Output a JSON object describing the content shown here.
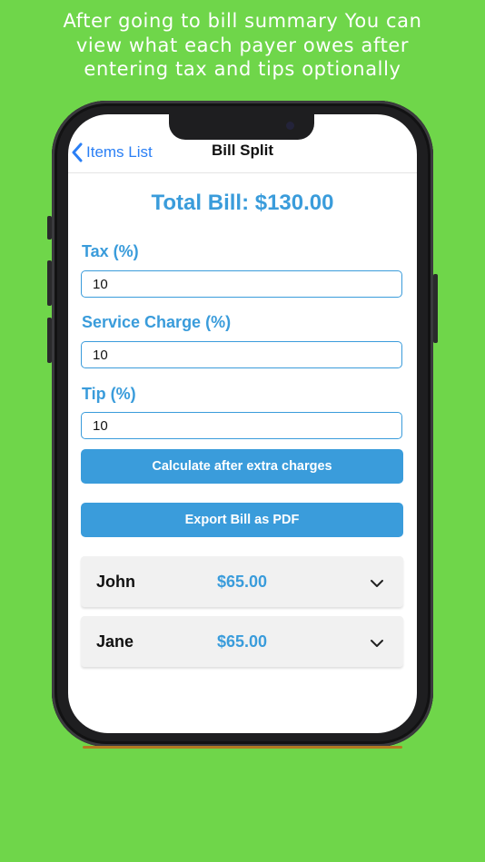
{
  "caption": {
    "line1": "After going to bill summary You can",
    "line2": "view what each payer owes after",
    "line3": "entering tax and tips optionally"
  },
  "nav": {
    "back_label": "Items List",
    "title": "Bill Split"
  },
  "bill": {
    "total_label": "Total Bill: $130.00"
  },
  "form": {
    "tax_label": "Tax (%)",
    "tax_value": "10",
    "service_label": "Service Charge (%)",
    "service_value": "10",
    "tip_label": "Tip (%)",
    "tip_value": "10"
  },
  "buttons": {
    "calculate_label": "Calculate after extra charges",
    "export_label": "Export Bill as PDF"
  },
  "payers": [
    {
      "name": "John",
      "amount": "$65.00"
    },
    {
      "name": "Jane",
      "amount": "$65.00"
    }
  ],
  "colors": {
    "background": "#6fd64a",
    "accent": "#3a9cdb",
    "link": "#2a7ff5"
  },
  "icons": {
    "back": "chevron-left-icon",
    "expand": "chevron-down-icon"
  }
}
